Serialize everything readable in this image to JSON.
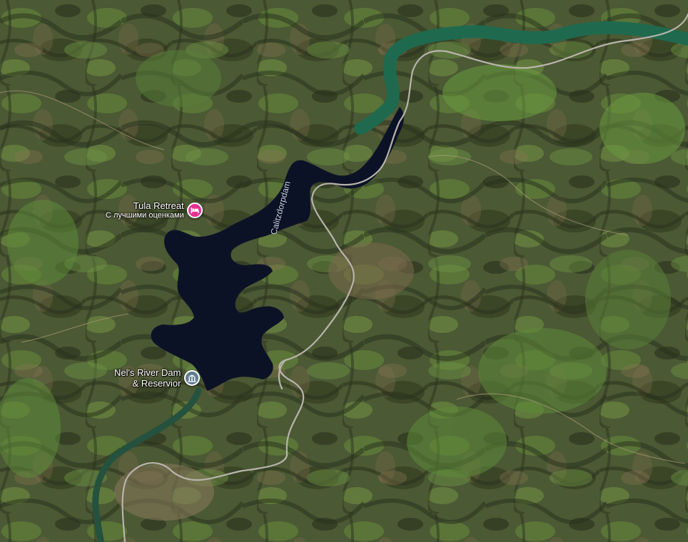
{
  "map": {
    "view": "satellite",
    "colors": {
      "water": "#0c1226",
      "river": "#1f6a4e",
      "road": "#b8b4ac",
      "hotel_pin": "#e6328f",
      "landmark_pin": "#607d8f"
    }
  },
  "places": {
    "tula_retreat": {
      "name": "Tula Retreat",
      "subtitle": "С лучшими оценками",
      "icon": "bed-icon"
    },
    "nels_river_dam": {
      "name_line1": "Nel's River Dam",
      "name_line2": "& Reservior",
      "icon": "landmark-icon"
    }
  },
  "water_labels": {
    "reservoir": "Calitzdorpdam"
  }
}
